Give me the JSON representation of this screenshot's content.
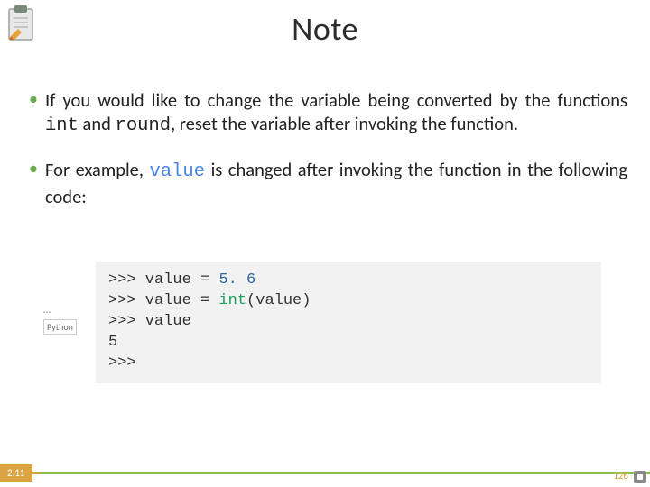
{
  "title": "Note",
  "bullets": [
    {
      "pre": "If you would like to change the variable being converted by the functions ",
      "mono1": "int",
      "mid1": " and ",
      "mono2": "round",
      "mid2": ", reset the variable after invoking the function.",
      "has_value": false
    },
    {
      "pre": "For example, ",
      "kw": "value",
      "post": " is changed after invoking the function in the following code:",
      "has_value": true
    }
  ],
  "pyBadge": {
    "dots": "…",
    "label": "Python"
  },
  "code": {
    "l1": {
      "prompt": ">>>",
      "text": " value = ",
      "num": "5. 6"
    },
    "l2": {
      "prompt": ">>>",
      "text": " value = ",
      "func": "int",
      "tail": "(value)"
    },
    "l3": {
      "prompt": ">>>",
      "text": " value"
    },
    "l4": {
      "out": "5"
    },
    "l5": {
      "prompt": ">>>"
    }
  },
  "footer": {
    "section": "2.11",
    "page": "126"
  }
}
